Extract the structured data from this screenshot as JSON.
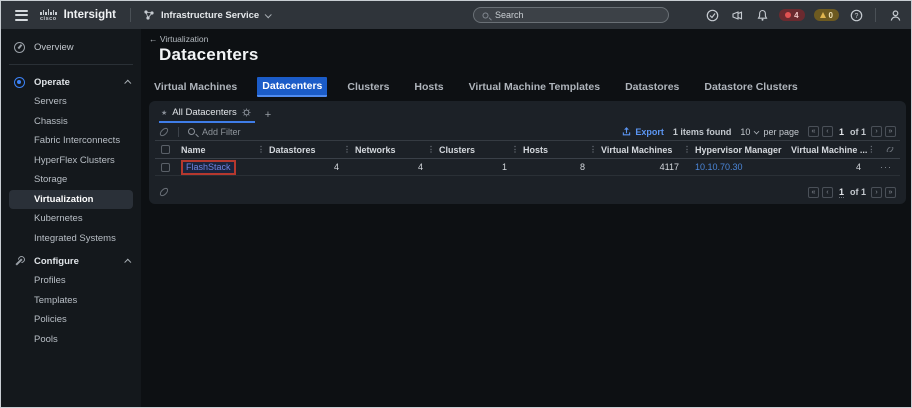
{
  "header": {
    "brand": "cisco",
    "app_title": "Intersight",
    "service_name": "Infrastructure Service",
    "search_placeholder": "Search",
    "alarm_critical_count": "4",
    "alarm_warning_count": "0"
  },
  "sidebar": {
    "overview_label": "Overview",
    "sections": [
      {
        "label": "Operate",
        "items": [
          "Servers",
          "Chassis",
          "Fabric Interconnects",
          "HyperFlex Clusters",
          "Storage",
          "Virtualization",
          "Kubernetes",
          "Integrated Systems"
        ]
      },
      {
        "label": "Configure",
        "items": [
          "Profiles",
          "Templates",
          "Policies",
          "Pools"
        ]
      }
    ],
    "selected_item": "Virtualization"
  },
  "page": {
    "breadcrumb": "← Virtualization",
    "title": "Datacenters",
    "tabs": [
      "Virtual Machines",
      "Datacenters",
      "Clusters",
      "Hosts",
      "Virtual Machine Templates",
      "Datastores",
      "Datastore Clusters"
    ],
    "selected_tab": "Datacenters"
  },
  "table": {
    "view_tab_label": "All Datacenters",
    "add_view_label": "+",
    "filter_placeholder": "Add Filter",
    "export_label": "Export",
    "items_found": "1 items found",
    "per_page_value": "10",
    "per_page_label": "per page",
    "page_current": "1",
    "page_of": "of 1",
    "columns": {
      "name": "Name",
      "datastores": "Datastores",
      "networks": "Networks",
      "clusters": "Clusters",
      "hosts": "Hosts",
      "virtual_machines": "Virtual Machines",
      "hypervisor_manager": "Hypervisor Manager",
      "virtual_machine_truncated": "Virtual Machine ..."
    },
    "rows": [
      {
        "name": "FlashStack",
        "datastores": "4",
        "networks": "4",
        "clusters": "1",
        "hosts": "8",
        "virtual_machines": "4117",
        "hypervisor_manager": "10.10.70.30",
        "virtual_machine_truncated": "4",
        "actions": "···"
      }
    ]
  },
  "colors": {
    "accent_blue": "#1b5cc8",
    "link_blue": "#4b86d8",
    "critical_red": "#e05252",
    "warning_yellow": "#e0b64f",
    "annotation_red": "#b5382e"
  }
}
